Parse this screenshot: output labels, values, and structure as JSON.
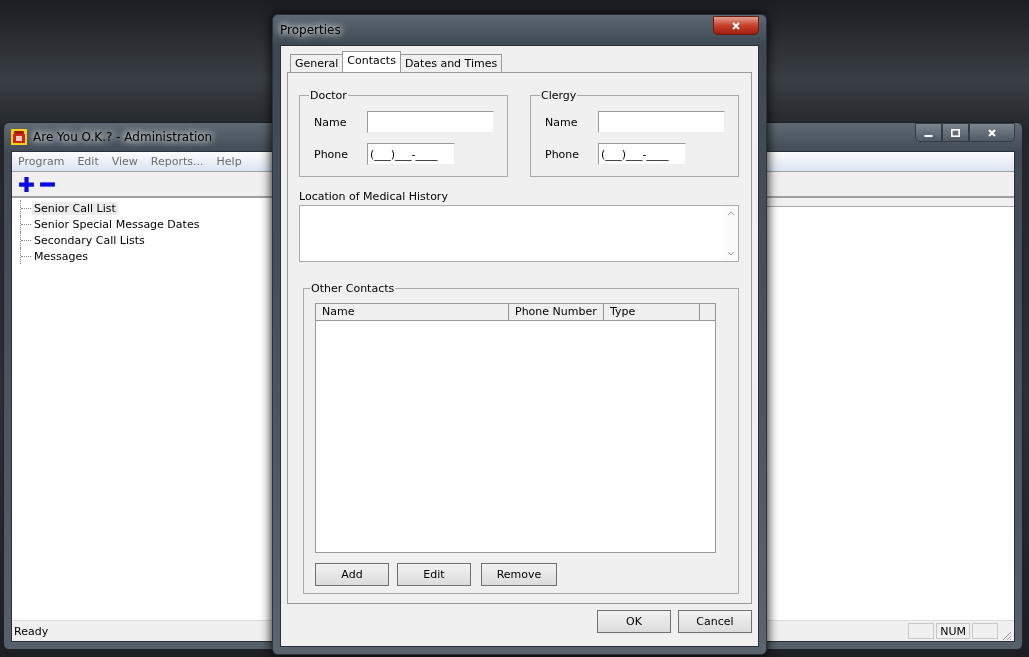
{
  "main_window": {
    "title": "Are You O.K.? - Administration",
    "menu": [
      "Program",
      "Edit",
      "View",
      "Reports...",
      "Help"
    ],
    "tree": [
      {
        "label": "Senior Call List",
        "selected": true
      },
      {
        "label": "Senior Special Message Dates",
        "selected": false
      },
      {
        "label": "Secondary Call Lists",
        "selected": false
      },
      {
        "label": "Messages",
        "selected": false
      }
    ],
    "status_bar": {
      "text": "Ready",
      "indicators": [
        {
          "kind": "panel"
        },
        {
          "kind": "panel",
          "text": "NUM"
        },
        {
          "kind": "panel"
        }
      ]
    }
  },
  "dialog": {
    "title": "Properties",
    "tabs": [
      {
        "label": "General",
        "selected": false
      },
      {
        "label": "Contacts",
        "selected": true
      },
      {
        "label": "Dates and Times",
        "selected": false
      }
    ],
    "groups": [
      {
        "title": "Doctor",
        "fields": [
          {
            "label": "Name"
          },
          {
            "label": "Phone",
            "value": "(___)___-____"
          }
        ]
      },
      {
        "title": "Clergy",
        "fields": [
          {
            "label": "Name"
          },
          {
            "label": "Phone",
            "value": "(___)___-____"
          }
        ]
      }
    ],
    "medical_history_label": "Location of Medical History",
    "other_contacts": {
      "title": "Other Contacts",
      "columns": [
        "Name",
        "Phone Number",
        "Type"
      ],
      "buttons": [
        "Add",
        "Edit",
        "Remove"
      ]
    },
    "buttons": [
      "OK",
      "Cancel"
    ]
  }
}
